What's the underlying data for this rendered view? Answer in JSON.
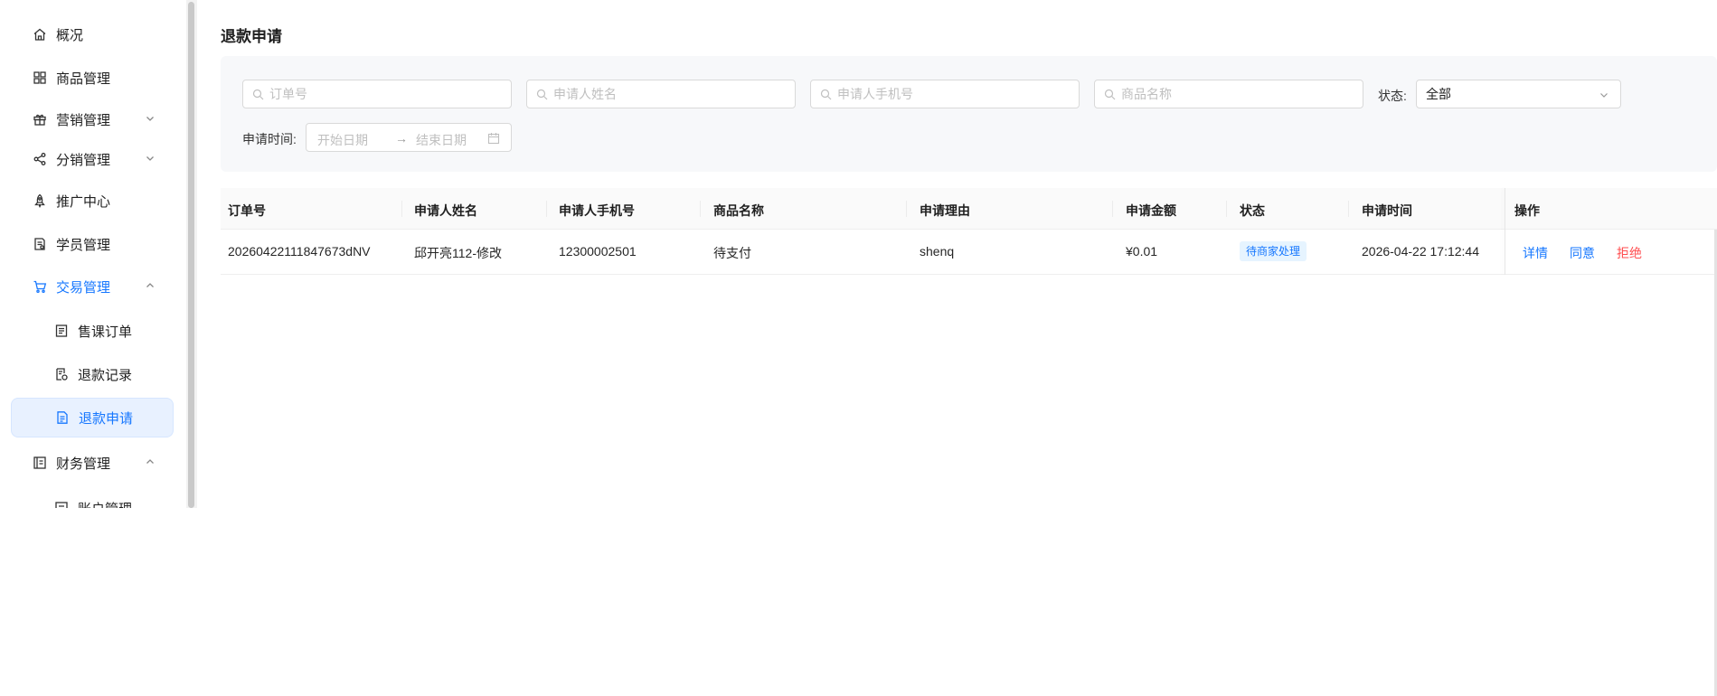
{
  "sidebar": {
    "items": [
      {
        "label": "概况",
        "icon": "home-icon"
      },
      {
        "label": "商品管理",
        "icon": "grid-icon"
      },
      {
        "label": "营销管理",
        "icon": "gift-icon",
        "expand": "chevron-down-icon"
      },
      {
        "label": "分销管理",
        "icon": "share-icon",
        "expand": "chevron-down-icon"
      },
      {
        "label": "推广中心",
        "icon": "rocket-icon"
      },
      {
        "label": "学员管理",
        "icon": "student-icon"
      },
      {
        "label": "交易管理",
        "icon": "cart-icon",
        "expand": "chevron-up-icon"
      },
      {
        "label": "售课订单",
        "icon": "order-icon"
      },
      {
        "label": "退款记录",
        "icon": "refund-record-icon"
      },
      {
        "label": "退款申请",
        "icon": "refund-apply-icon"
      },
      {
        "label": "财务管理",
        "icon": "finance-icon",
        "expand": "chevron-up-icon"
      },
      {
        "label": "账户管理",
        "icon": "account-icon"
      }
    ]
  },
  "page": {
    "title": "退款申请"
  },
  "filters": {
    "order_no_placeholder": "订单号",
    "applicant_name_placeholder": "申请人姓名",
    "applicant_phone_placeholder": "申请人手机号",
    "product_name_placeholder": "商品名称",
    "status_label": "状态:",
    "status_value": "全部",
    "time_label": "申请时间:",
    "start_date_placeholder": "开始日期",
    "end_date_placeholder": "结束日期",
    "range_arrow": "→"
  },
  "table": {
    "headers": [
      "订单号",
      "申请人姓名",
      "申请人手机号",
      "商品名称",
      "申请理由",
      "申请金额",
      "状态",
      "申请时间",
      "操作"
    ],
    "rows": [
      {
        "order_no": "20260422111847673dNV",
        "applicant_name": "邱开亮112-修改",
        "phone": "12300002501",
        "product": "待支付",
        "reason": "shenq",
        "amount": "¥0.01",
        "status": "待商家处理",
        "time": "2026-04-22 17:12:44",
        "actions": {
          "detail": "详情",
          "agree": "同意",
          "reject": "拒绝"
        }
      }
    ]
  },
  "colors": {
    "accent": "#1677ff",
    "danger": "#ff4d4f",
    "selected_bg": "#e8f1ff"
  }
}
